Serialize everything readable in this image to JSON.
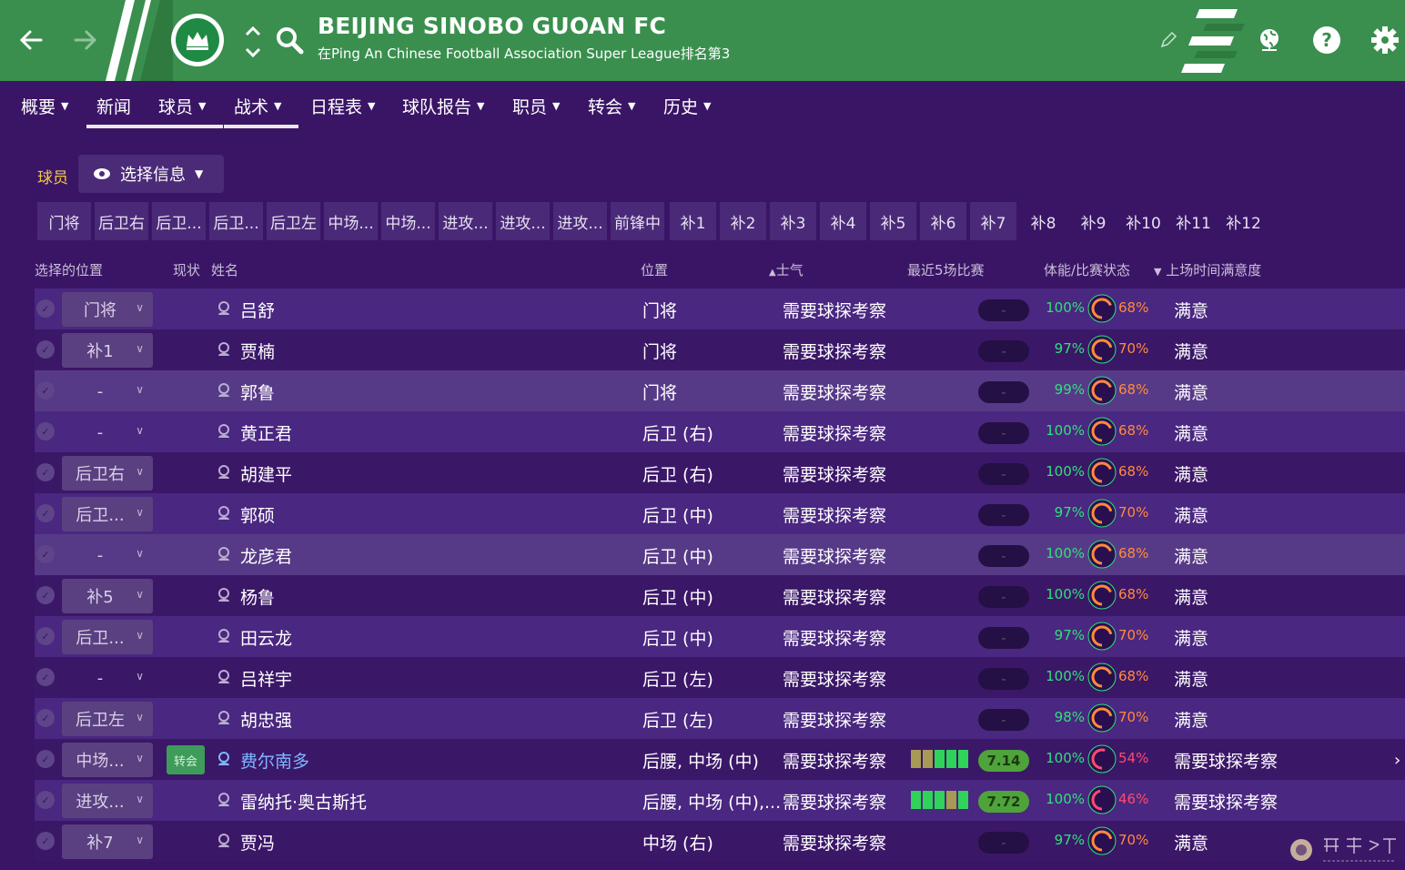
{
  "header": {
    "club_name": "BEIJING SINOBO GUOAN FC",
    "subtitle": "在Ping An Chinese Football Association Super League排名第3",
    "icons": [
      "back-arrow-icon",
      "forward-arrow-icon",
      "club-crest-icon",
      "up-down-icon",
      "search-icon",
      "edit-pencil-icon",
      "globe-icon",
      "help-icon",
      "settings-icon"
    ]
  },
  "menu": {
    "items": [
      "概要",
      "新闻",
      "球员",
      "战术",
      "日程表",
      "球队报告",
      "职员",
      "转会",
      "历史"
    ],
    "active": "新闻"
  },
  "filter": {
    "label": "球员",
    "select_info": "选择信息"
  },
  "position_tabs": [
    "门将",
    "后卫右",
    "后卫...",
    "后卫...",
    "后卫左",
    "中场...",
    "中场...",
    "进攻...",
    "进攻...",
    "进攻...",
    "前锋中",
    "补1",
    "补2",
    "补3",
    "补4",
    "补5",
    "补6",
    "补7",
    "补8",
    "补9",
    "补10",
    "补11",
    "补12"
  ],
  "table": {
    "headers": {
      "selected_position": "选择的位置",
      "status": "现状",
      "name": "姓名",
      "position": "位置",
      "morale": "士气",
      "last5": "最近5场比赛",
      "condition": "体能/比赛状态",
      "playing_time": "上场时间满意度"
    },
    "rows": [
      {
        "sel": "门将",
        "status": "",
        "name": "吕舒",
        "pos": "门将",
        "morale": "需要球探考察",
        "form": [],
        "rating": "-",
        "fitness": "100%",
        "sharpness": "68%",
        "satisfaction": "满意"
      },
      {
        "sel": "补1",
        "status": "",
        "name": "贾楠",
        "pos": "门将",
        "morale": "需要球探考察",
        "form": [],
        "rating": "-",
        "fitness": "97%",
        "sharpness": "70%",
        "satisfaction": "满意"
      },
      {
        "sel": "-",
        "status": "",
        "name": "郭鲁",
        "pos": "门将",
        "morale": "需要球探考察",
        "form": [],
        "rating": "-",
        "fitness": "99%",
        "sharpness": "68%",
        "satisfaction": "满意"
      },
      {
        "sel": "-",
        "status": "",
        "name": "黄正君",
        "pos": "后卫 (右)",
        "morale": "需要球探考察",
        "form": [],
        "rating": "-",
        "fitness": "100%",
        "sharpness": "68%",
        "satisfaction": "满意"
      },
      {
        "sel": "后卫右",
        "status": "",
        "name": "胡建平",
        "pos": "后卫 (右)",
        "morale": "需要球探考察",
        "form": [],
        "rating": "-",
        "fitness": "100%",
        "sharpness": "68%",
        "satisfaction": "满意"
      },
      {
        "sel": "后卫...",
        "status": "",
        "name": "郭硕",
        "pos": "后卫 (中)",
        "morale": "需要球探考察",
        "form": [],
        "rating": "-",
        "fitness": "97%",
        "sharpness": "70%",
        "satisfaction": "满意"
      },
      {
        "sel": "-",
        "status": "",
        "name": "龙彦君",
        "pos": "后卫 (中)",
        "morale": "需要球探考察",
        "form": [],
        "rating": "-",
        "fitness": "100%",
        "sharpness": "68%",
        "satisfaction": "满意"
      },
      {
        "sel": "补5",
        "status": "",
        "name": "杨鲁",
        "pos": "后卫 (中)",
        "morale": "需要球探考察",
        "form": [],
        "rating": "-",
        "fitness": "100%",
        "sharpness": "68%",
        "satisfaction": "满意"
      },
      {
        "sel": "后卫...",
        "status": "",
        "name": "田云龙",
        "pos": "后卫 (中)",
        "morale": "需要球探考察",
        "form": [],
        "rating": "-",
        "fitness": "97%",
        "sharpness": "70%",
        "satisfaction": "满意"
      },
      {
        "sel": "-",
        "status": "",
        "name": "吕祥宇",
        "pos": "后卫 (左)",
        "morale": "需要球探考察",
        "form": [],
        "rating": "-",
        "fitness": "100%",
        "sharpness": "68%",
        "satisfaction": "满意"
      },
      {
        "sel": "后卫左",
        "status": "",
        "name": "胡忠强",
        "pos": "后卫 (左)",
        "morale": "需要球探考察",
        "form": [],
        "rating": "-",
        "fitness": "98%",
        "sharpness": "70%",
        "satisfaction": "满意"
      },
      {
        "sel": "中场...",
        "status": "转会",
        "name": "费尔南多",
        "pos": "后腰, 中场 (中)",
        "morale": "需要球探考察",
        "form": [
          "#a89a55",
          "#a89a55",
          "#2fd35a",
          "#2fd35a",
          "#2fd35a"
        ],
        "rating": "7.14",
        "fitness": "100%",
        "sharpness": "54%",
        "satisfaction": "需要球探考察",
        "link": true
      },
      {
        "sel": "进攻...",
        "status": "",
        "name": "雷纳托·奥古斯托",
        "pos": "后腰, 中场 (中),...",
        "morale": "需要球探考察",
        "form": [
          "#2fd35a",
          "#2fd35a",
          "#2fd35a",
          "#a89a55",
          "#2fd35a"
        ],
        "rating": "7.72",
        "fitness": "100%",
        "sharpness": "46%",
        "satisfaction": "需要球探考察"
      },
      {
        "sel": "补7",
        "status": "",
        "name": "贾冯",
        "pos": "中场 (右)",
        "morale": "需要球探考察",
        "form": [],
        "rating": "-",
        "fitness": "97%",
        "sharpness": "70%",
        "satisfaction": "满意"
      }
    ]
  },
  "colors": {
    "bg": "#3a1566",
    "header_green": "#3a8f4e",
    "fitness": "#2de27a",
    "sharp_orange": "#ff8a3d",
    "sharp_red": "#ff4a6e",
    "filter_label": "#f2c744"
  }
}
